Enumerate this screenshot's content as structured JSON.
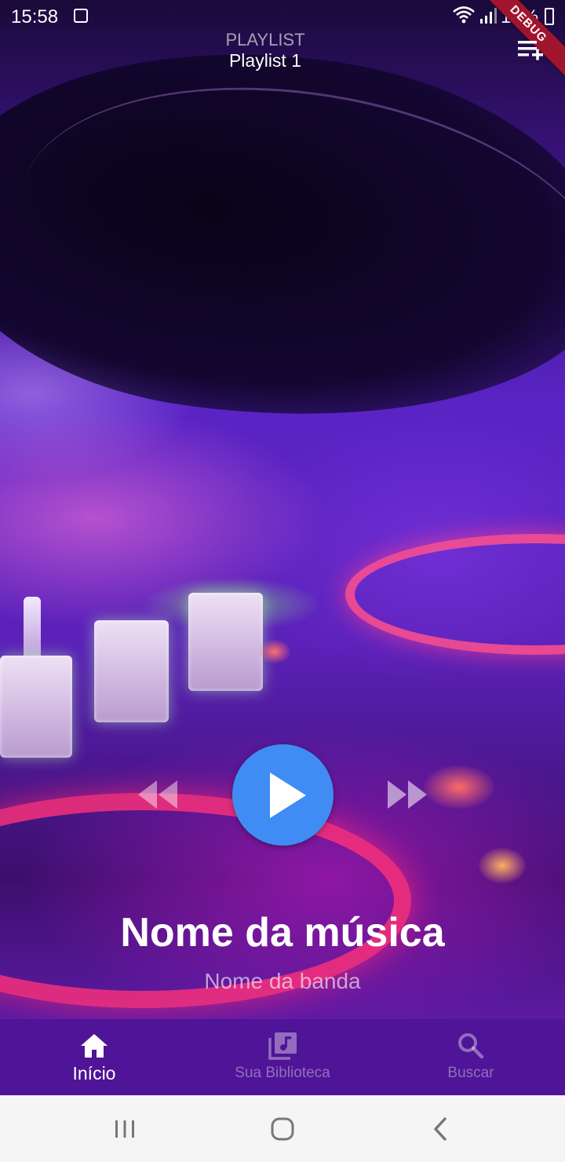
{
  "status_bar": {
    "time": "15:58",
    "battery_percent": "18%"
  },
  "debug_banner": "DEBUG",
  "header": {
    "eyebrow": "PLAYLIST",
    "title": "Playlist 1"
  },
  "player": {
    "song_title": "Nome da música",
    "band_name": "Nome da banda",
    "play_color": "#3f8cf5"
  },
  "bottom_nav": {
    "items": [
      {
        "label": "Início",
        "icon": "home-icon",
        "active": true
      },
      {
        "label": "Sua Biblioteca",
        "icon": "library-music-icon",
        "active": false
      },
      {
        "label": "Buscar",
        "icon": "search-icon",
        "active": false
      }
    ],
    "background": "#4f1497"
  },
  "system_nav": {
    "buttons": [
      "recents-icon",
      "home-circle-icon",
      "back-icon"
    ]
  }
}
